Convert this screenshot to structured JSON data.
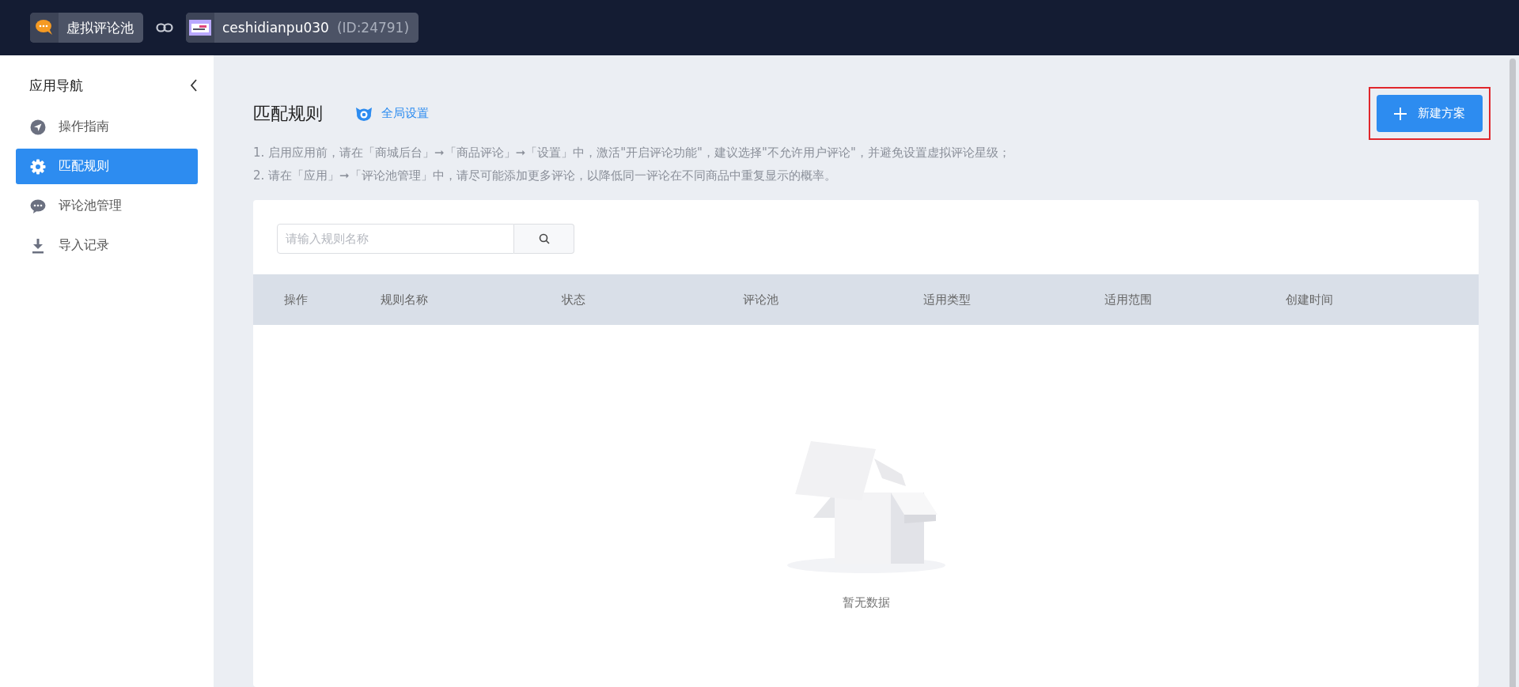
{
  "topbar": {
    "app_name": "虚拟评论池",
    "shop_name": "ceshidianpu030",
    "shop_id": "(ID:24791)"
  },
  "sidebar": {
    "title": "应用导航",
    "items": [
      {
        "label": "操作指南",
        "selected": false
      },
      {
        "label": "匹配规则",
        "selected": true
      },
      {
        "label": "评论池管理",
        "selected": false
      },
      {
        "label": "导入记录",
        "selected": false
      }
    ]
  },
  "page": {
    "title": "匹配规则",
    "global_settings": "全局设置",
    "new_button": {
      "label": "新建方案",
      "highlighted": true
    },
    "notes": [
      "1. 启用应用前，请在「商城后台」➞「商品评论」➞「设置」中，激活\"开启评论功能\"，建议选择\"不允许用户评论\"，并避免设置虚拟评论星级；",
      "2. 请在「应用」➞「评论池管理」中，请尽可能添加更多评论，以降低同一评论在不同商品中重复显示的概率。"
    ]
  },
  "search": {
    "placeholder": "请输入规则名称"
  },
  "table": {
    "columns": [
      "操作",
      "规则名称",
      "状态",
      "评论池",
      "适用类型",
      "适用范围",
      "创建时间"
    ],
    "empty_text": "暂无数据"
  }
}
